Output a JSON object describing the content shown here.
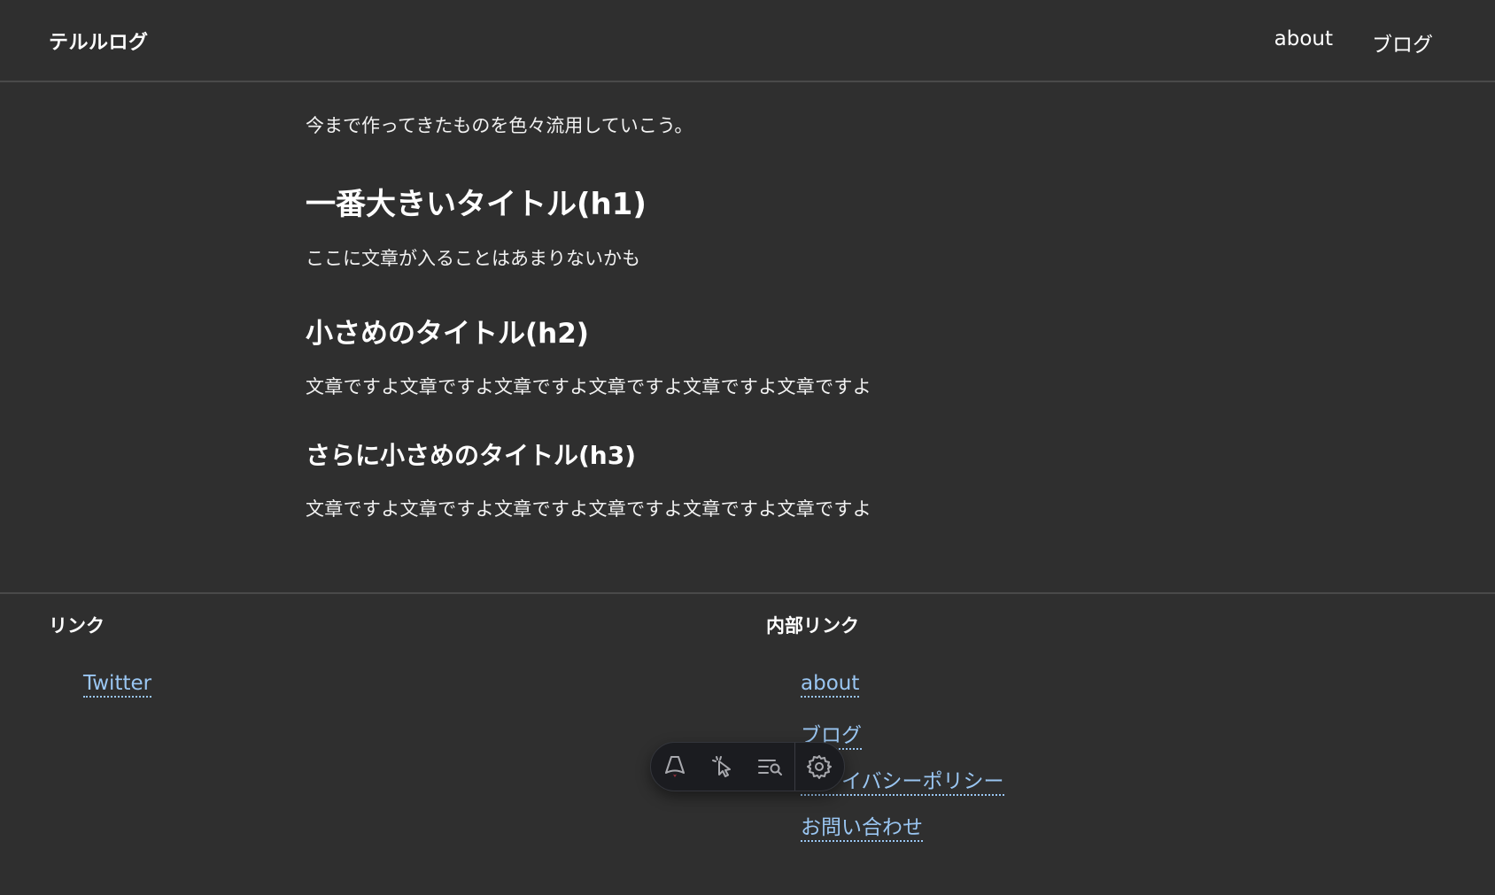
{
  "header": {
    "site_title": "テルルログ",
    "nav": [
      {
        "label": "about"
      },
      {
        "label": "ブログ"
      }
    ]
  },
  "main": {
    "intro": "今まで作ってきたものを色々流用していこう。",
    "h1": "一番大きいタイトル(h1)",
    "p1": "ここに文章が入ることはあまりないかも",
    "h2": "小さめのタイトル(h2)",
    "p2": "文章ですよ文章ですよ文章ですよ文章ですよ文章ですよ文章ですよ",
    "h3": "さらに小さめのタイトル(h3)",
    "p3": "文章ですよ文章ですよ文章ですよ文章ですよ文章ですよ文章ですよ"
  },
  "footer": {
    "links_title": "リンク",
    "links": [
      {
        "label": "Twitter"
      }
    ],
    "internal_title": "内部リンク",
    "internal_links": [
      {
        "label": "about"
      },
      {
        "label": "ブログ"
      },
      {
        "label": "プライバシーポリシー"
      },
      {
        "label": "お問い合わせ"
      }
    ]
  },
  "devbar": {
    "icons": [
      "astro-logo-icon",
      "inspect-cursor-icon",
      "audit-list-icon",
      "settings-gear-icon"
    ]
  },
  "colors": {
    "background": "#2f2f2f",
    "link": "#9ac6f2",
    "divider": "#4a4a4a"
  }
}
